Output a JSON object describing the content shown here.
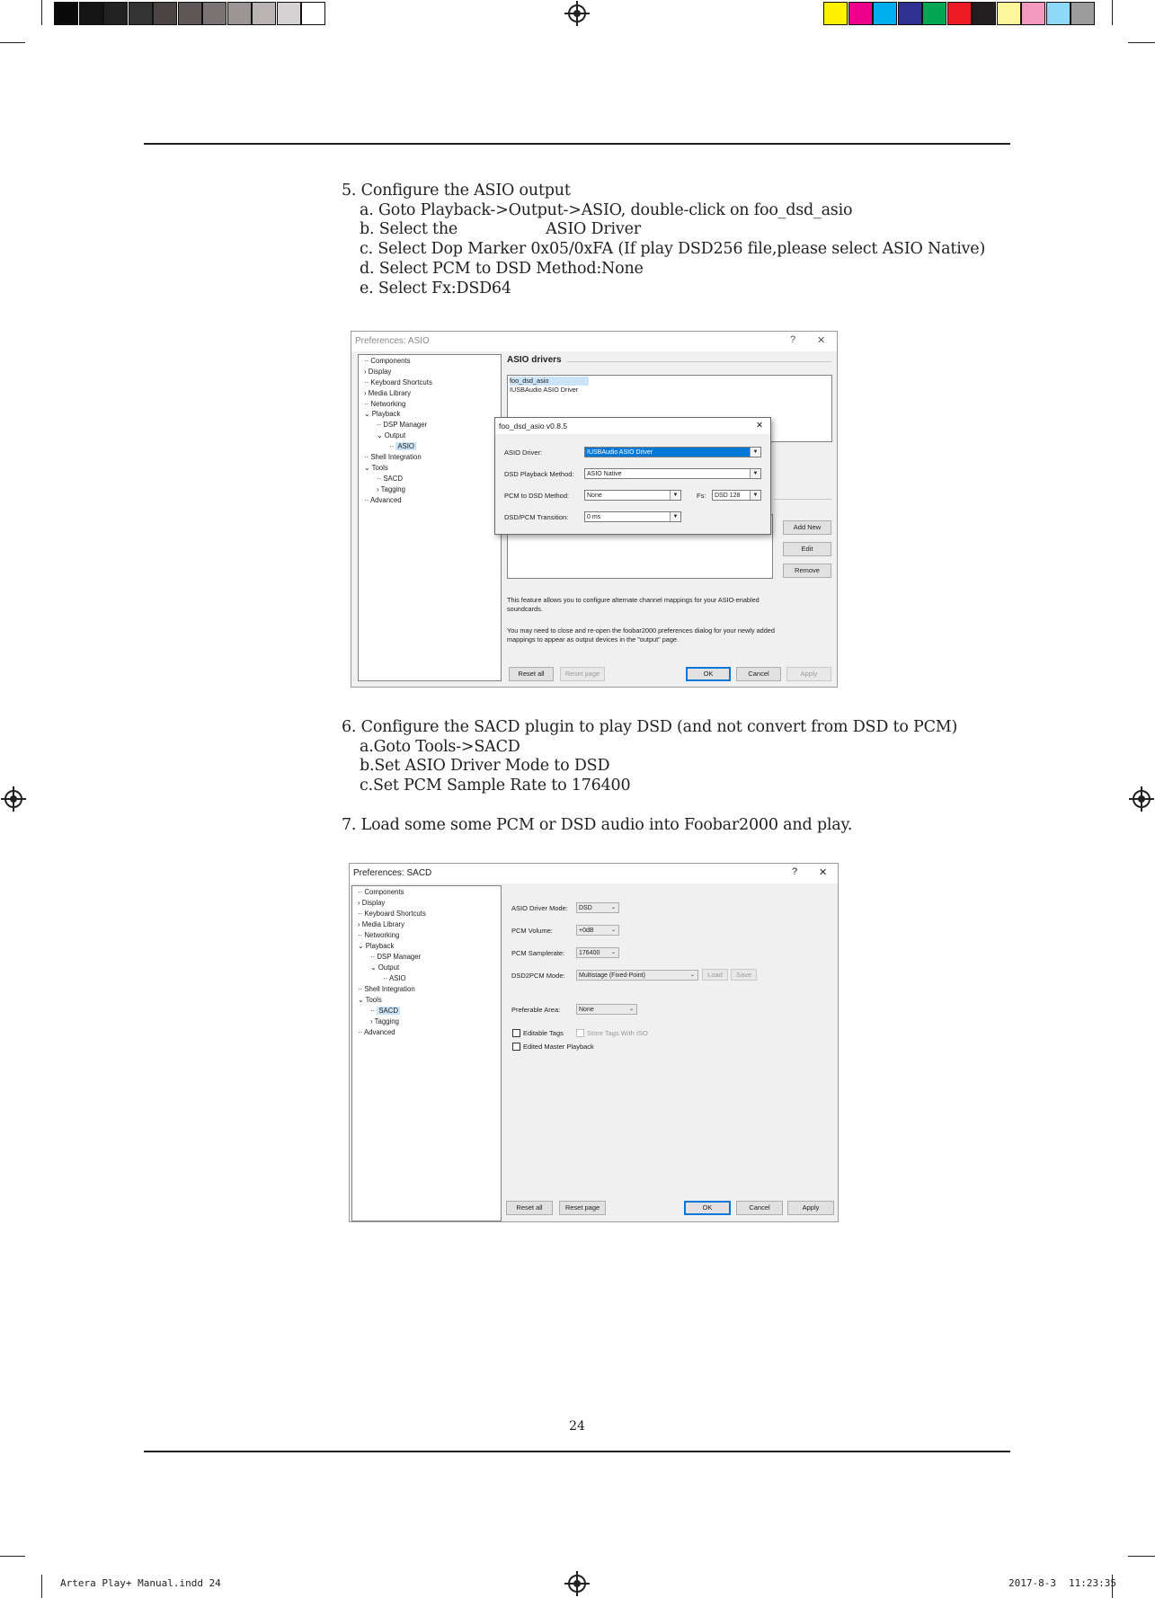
{
  "print_marks": {
    "swatches_left": [
      "#0a0a0a",
      "#151515",
      "#222222",
      "#333333",
      "#4a4445",
      "#5e5657",
      "#7a7374",
      "#9c9596",
      "#b9b3b4",
      "#d6d2d3",
      "#ffffff"
    ],
    "swatches_right": [
      "#fff200",
      "#ec008c",
      "#00aeef",
      "#2e3192",
      "#00a651",
      "#ed1c24",
      "#231f20",
      "#fff799",
      "#f49ac1",
      "#8ed8f8",
      "#9b9b9b"
    ]
  },
  "step5": {
    "heading": "5. Configure the ASIO output",
    "a": "a. Goto Playback->Output->ASIO, double-click on foo_dsd_asio",
    "b_left": "b. Select the",
    "b_right": "ASIO Driver",
    "c": "c. Select Dop Marker 0x05/0xFA (If play DSD256 file,please select ASIO Native)",
    "d": "d. Select PCM to DSD Method:None",
    "e": "e. Select Fx:DSD64"
  },
  "asio_window": {
    "title": "Preferences: ASIO",
    "help": "?",
    "close": "✕",
    "tree": [
      "Components",
      "Display",
      "Keyboard Shortcuts",
      "Media Library",
      "Networking",
      "Playback",
      "DSP Manager",
      "Output",
      "ASIO",
      "Shell Integration",
      "Tools",
      "SACD",
      "Tagging",
      "Advanced"
    ],
    "section_title": "ASIO drivers",
    "drivers": [
      "foo_dsd_asio",
      "IUSBAudio ASIO Driver"
    ],
    "buttons": {
      "add_new": "Add New",
      "edit": "Edit",
      "remove": "Remove",
      "reset_all": "Reset all",
      "reset_page": "Reset page",
      "ok": "OK",
      "cancel": "Cancel",
      "apply": "Apply"
    },
    "note1": "This feature allows you to configure alternate channel mappings for your ASIO-enabled soundcards.",
    "note2": "You may need to close and re-open the foobar2000 preferences dialog for your newly added mappings to appear as output devices in the \"output\" page.",
    "dialog": {
      "title": "foo_dsd_asio v0.8.5",
      "close": "✕",
      "asio_driver_label": "ASIO Driver:",
      "asio_driver_value": "IUSBAudio ASIO Driver",
      "playback_method_label": "DSD Playback Method:",
      "playback_method_value": "ASIO Native",
      "pcm_to_dsd_label": "PCM to DSD Method:",
      "pcm_to_dsd_value": "None",
      "fs_label": "Fs:",
      "fs_value": "DSD 128",
      "transition_label": "DSD/PCM Transition:",
      "transition_value": "0 ms"
    }
  },
  "step6": {
    "heading": "6. Configure the SACD plugin to play DSD (and not convert from DSD to PCM)",
    "a": "a.Goto Tools->SACD",
    "b": "b.Set ASIO Driver Mode to DSD",
    "c": "c.Set PCM Sample Rate to 176400"
  },
  "step7": {
    "heading": "7. Load some some PCM or DSD audio into Foobar2000 and play."
  },
  "sacd_window": {
    "title": "Preferences: SACD",
    "help": "?",
    "close": "✕",
    "tree": [
      "Components",
      "Display",
      "Keyboard Shortcuts",
      "Media Library",
      "Networking",
      "Playback",
      "DSP Manager",
      "Output",
      "ASIO",
      "Shell Integration",
      "Tools",
      "SACD",
      "Tagging",
      "Advanced"
    ],
    "fields": {
      "driver_mode_label": "ASIO Driver Mode:",
      "driver_mode_value": "DSD",
      "volume_label": "PCM Volume:",
      "volume_value": "+0dB",
      "samplerate_label": "PCM Samplerate:",
      "samplerate_value": "176400",
      "dsd2pcm_label": "DSD2PCM Mode:",
      "dsd2pcm_value": "Multistage (Fixed-Point)",
      "load": "Load",
      "save": "Save",
      "area_label": "Preferable Area:",
      "area_value": "None",
      "editable_tags": "Editable Tags",
      "store_tags": "Store Tags With ISO",
      "edited_master": "Edited Master Playback"
    },
    "buttons": {
      "reset_all": "Reset all",
      "reset_page": "Reset page",
      "ok": "OK",
      "cancel": "Cancel",
      "apply": "Apply"
    }
  },
  "page_number": "24",
  "footer": {
    "file": "Artera Play+ Manual.indd   24",
    "date": "2017-8-3",
    "time": "11:23:35"
  }
}
